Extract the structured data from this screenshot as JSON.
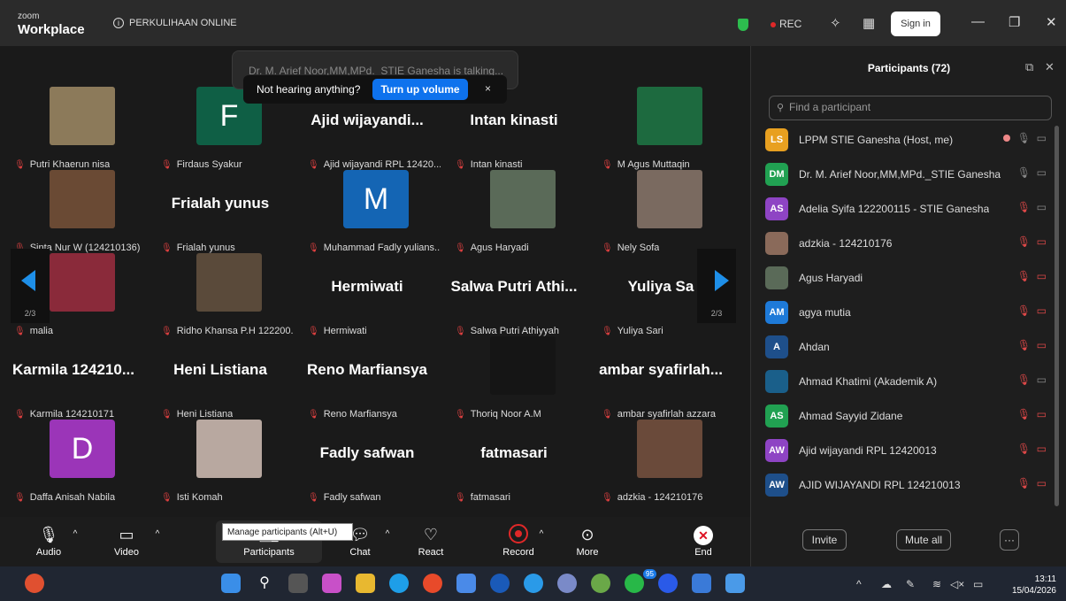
{
  "app": {
    "brand_small": "zoom",
    "brand_big": "Workplace",
    "meeting_title": "PERKULIHAAN ONLINE",
    "rec_label": "REC",
    "signin_label": "Sign in"
  },
  "toast": {
    "background_text": "Dr. M. Arief Noor,MM,MPd._STIE Ganesha is talking...",
    "message": "Not hearing anything?",
    "button": "Turn up volume",
    "close": "×"
  },
  "grid": {
    "page_indicator": "2/3",
    "tiles": [
      {
        "label": "Putri Khaerun nisa",
        "kind": "photo",
        "color": "#8c7a5a"
      },
      {
        "label": "Firdaus Syakur",
        "kind": "avatar",
        "initial": "F",
        "color": "#0f5f45"
      },
      {
        "label": "Ajid wijayandi RPL 12420...",
        "kind": "text",
        "big": "Ajid  wijayandi..."
      },
      {
        "label": "Intan kinasti",
        "kind": "text",
        "big": "Intan kinasti"
      },
      {
        "label": "M Agus Muttaqin",
        "kind": "photo",
        "color": "#1d6a3f"
      },
      {
        "label": "Sinta Nur W (124210136)",
        "kind": "photo",
        "color": "#6a4a34"
      },
      {
        "label": "Frialah yunus",
        "kind": "text",
        "big": "Frialah yunus"
      },
      {
        "label": "Muhammad Fadly yulians...",
        "kind": "avatar",
        "initial": "M",
        "color": "#1465b4"
      },
      {
        "label": "Agus Haryadi",
        "kind": "photo",
        "color": "#5a6a58"
      },
      {
        "label": "Nely Sofa",
        "kind": "photo",
        "color": "#7a6a60"
      },
      {
        "label": "malia",
        "kind": "photo",
        "color": "#8a2a3a"
      },
      {
        "label": "Ridho Khansa P.H 122200...",
        "kind": "photo",
        "color": "#5a4a3a"
      },
      {
        "label": "Hermiwati",
        "kind": "text",
        "big": "Hermiwati"
      },
      {
        "label": "Salwa Putri Athiyyah",
        "kind": "text",
        "big": "Salwa Putri Athi..."
      },
      {
        "label": "Yuliya Sari",
        "kind": "text",
        "big": "Yuliya Sa"
      },
      {
        "label": "Karmila 124210171",
        "kind": "text",
        "big": "Karmila  124210..."
      },
      {
        "label": "Heni Listiana",
        "kind": "text",
        "big": "Heni Listiana"
      },
      {
        "label": "Reno Marfiansya",
        "kind": "text",
        "big": "Reno Marfiansya"
      },
      {
        "label": "Thoriq Noor A.M",
        "kind": "blank",
        "color": "#151515"
      },
      {
        "label": "ambar syafirlah azzara",
        "kind": "text",
        "big": "ambar  syafirlah..."
      },
      {
        "label": "Daffa Anisah Nabila",
        "kind": "avatar",
        "initial": "D",
        "color": "#9b35b8"
      },
      {
        "label": "Isti Komah",
        "kind": "photo",
        "color": "#b8a8a0"
      },
      {
        "label": "Fadly safwan",
        "kind": "text",
        "big": "Fadly safwan"
      },
      {
        "label": "fatmasari",
        "kind": "text",
        "big": "fatmasari"
      },
      {
        "label": "adzkia - 124210176",
        "kind": "photo",
        "color": "#6a4a3a"
      }
    ]
  },
  "toolbar": {
    "audio": "Audio",
    "video": "Video",
    "participants": "Participants",
    "chat": "Chat",
    "react": "React",
    "record": "Record",
    "more": "More",
    "end": "End",
    "tooltip": "Manage participants (Alt+U)"
  },
  "panel": {
    "title": "Participants (72)",
    "search_placeholder": "Find a participant",
    "invite": "Invite",
    "mute_all": "Mute all",
    "more": "···",
    "participants": [
      {
        "initials": "LS",
        "color": "#e8a020",
        "name": "LPPM STIE Ganesha (Host, me)",
        "mic": "on",
        "video": "off",
        "rec": true
      },
      {
        "initials": "DM",
        "color": "#21a152",
        "name": "Dr. M. Arief Noor,MM,MPd._STIE Ganesha",
        "mic": "on",
        "video": "off"
      },
      {
        "initials": "AS",
        "color": "#8e44c4",
        "name": "Adelia Syifa 122200115 - STIE Ganesha",
        "mic": "muted",
        "video": "off"
      },
      {
        "initials": "",
        "color": "#8a6a5a",
        "name": "adzkia - 124210176",
        "mic": "muted",
        "video": "muted"
      },
      {
        "initials": "",
        "color": "#5a6a58",
        "name": "Agus Haryadi",
        "mic": "muted",
        "video": "muted"
      },
      {
        "initials": "AM",
        "color": "#1e7ad8",
        "name": "agya mutia",
        "mic": "muted",
        "video": "muted"
      },
      {
        "initials": "A",
        "color": "#1e4f8a",
        "name": "Ahdan",
        "mic": "muted",
        "video": "muted"
      },
      {
        "initials": "",
        "color": "#1a5f8a",
        "name": "Ahmad Khatimi (Akademik A)",
        "mic": "muted",
        "video": "off"
      },
      {
        "initials": "AS",
        "color": "#21a152",
        "name": "Ahmad Sayyid Zidane",
        "mic": "muted",
        "video": "muted"
      },
      {
        "initials": "AW",
        "color": "#8e44c4",
        "name": "Ajid wijayandi RPL 12420013",
        "mic": "muted",
        "video": "muted"
      },
      {
        "initials": "AW",
        "color": "#1e4f8a",
        "name": "AJID WIJAYANDI RPL 124210013",
        "mic": "muted",
        "video": "muted"
      }
    ]
  },
  "taskbar": {
    "time": "13:11",
    "date": "15/04/2026",
    "badge": "95"
  }
}
